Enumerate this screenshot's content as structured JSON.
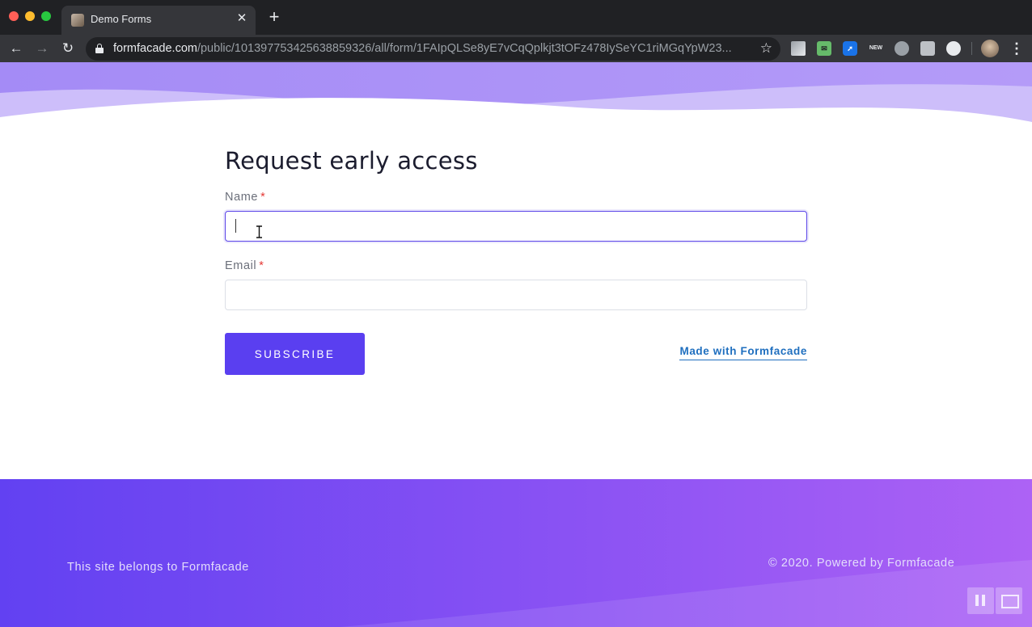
{
  "browser": {
    "tab_title": "Demo Forms",
    "url_host": "formfacade.com",
    "url_path": "/public/101397753425638859326/all/form/1FAIpQLSe8yE7vCqQplkjt3tOFz478IySeYC1riMGqYpW23...",
    "extension_new_badge": "NEW"
  },
  "form": {
    "title": "Request early access",
    "fields": [
      {
        "label": "Name",
        "required_mark": "*",
        "value": "",
        "focused": true
      },
      {
        "label": "Email",
        "required_mark": "*",
        "value": "",
        "focused": false
      }
    ],
    "submit_label": "SUBSCRIBE",
    "made_with": "Made with Formfacade"
  },
  "footer": {
    "left_text": "This site belongs to Formfacade",
    "right_text": "© 2020. Powered by Formfacade"
  },
  "colors": {
    "accent": "#5a3ff0",
    "link": "#1f6fbf",
    "footer_start": "#6241f2",
    "footer_end": "#ad62f5",
    "required": "#e53935"
  },
  "icons": [
    "back-icon",
    "forward-icon",
    "reload-icon",
    "lock-icon",
    "star-icon",
    "menu-dots-icon",
    "close-icon",
    "plus-icon",
    "pause-icon",
    "picture-in-picture-icon"
  ]
}
